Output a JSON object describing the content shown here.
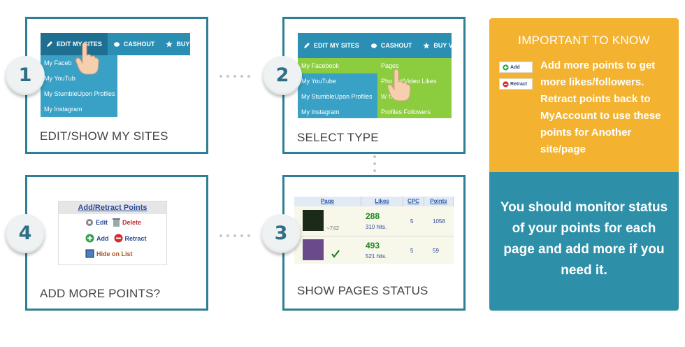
{
  "steps": [
    {
      "number": "1",
      "caption": "EDIT/SHOW MY SITES"
    },
    {
      "number": "2",
      "caption": "SELECT TYPE"
    },
    {
      "number": "3",
      "caption": "SHOW PAGES STATUS"
    },
    {
      "number": "4",
      "caption": "ADD MORE POINTS?"
    }
  ],
  "menu": {
    "edit_label": "EDIT MY SITES",
    "cashout_label": "CASHOUT",
    "buy_label_1": "BUY VI",
    "buy_label_2": "BUY V"
  },
  "sites_menu": [
    "My Facebook",
    "My YouTube",
    "My StumbleUpon Profiles",
    "My Instagram"
  ],
  "sites_menu_clipped": [
    "My Faceb",
    "My YouTub",
    "My StumbleUpon Profiles",
    "My Instagram"
  ],
  "type_menu": [
    "Pages",
    "Photos/Post/Video Likes",
    "Website Shares",
    "Profiles Followers"
  ],
  "type_menu_clipped": [
    "Pages",
    "Pho   ost/Video Likes",
    "W      hares",
    "Profiles Followers"
  ],
  "add_retract": {
    "title": "Add/Retract Points",
    "edit": "Edit",
    "delete": "Delete",
    "add": "Add",
    "retract": "Retract",
    "hide": "Hide on List"
  },
  "status_table": {
    "headers": [
      "Page",
      "Likes",
      "CPC",
      "Points"
    ],
    "rows": [
      {
        "thumb_label": "~742",
        "likes": "288",
        "hits": "310 hits.",
        "cpc": "5",
        "points": "1058"
      },
      {
        "thumb_label": "",
        "likes": "493",
        "hits": "521 hits.",
        "cpc": "5",
        "points": "59"
      }
    ]
  },
  "important": {
    "title": "IMPORTANT TO KNOW",
    "add_btn": "Add",
    "retract_btn": "Retract",
    "text": "Add more points to get more likes/followers. Retract points back to MyAccount to use these points for Another site/page"
  },
  "monitor_text": "You should monitor status of your points for each page and add more if you need it.",
  "colors": {
    "card_border": "#2e7f96",
    "menu_blue": "#2b8fb4",
    "menu_green": "#8ccd3f",
    "panel_yellow": "#f3b330",
    "panel_teal": "#2e8fa9"
  }
}
